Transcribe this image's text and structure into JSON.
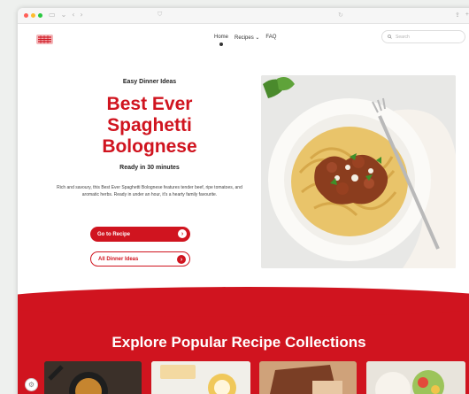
{
  "colors": {
    "brand": "#d0141f",
    "text": "#222222",
    "background": "#ffffff"
  },
  "browser": {
    "traffic_lights": [
      "#ff5f57",
      "#febc2e",
      "#28c840"
    ],
    "icons": [
      "sidebar-icon",
      "back-icon",
      "forward-icon",
      "shield-icon",
      "refresh-icon",
      "share-icon",
      "new-tab-icon"
    ]
  },
  "nav": {
    "links": [
      {
        "label": "Home"
      },
      {
        "label": "Recipes ⌄"
      },
      {
        "label": "FAQ"
      }
    ],
    "search_placeholder": "Search"
  },
  "hero": {
    "eyebrow": "Easy Dinner Ideas",
    "title_lines": [
      "Best Ever",
      "Spaghetti",
      "Bolognese"
    ],
    "ready": "Ready in 30 minutes",
    "description": "Rich and savoury, this Best Ever Spaghetti Bolognese features tender beef, ripe tomatoes, and aromatic herbs. Ready in under an hour, it's a hearty family favourite.",
    "primary_button": "Go to Recipe",
    "secondary_button": "All Dinner Ideas",
    "image": "spaghetti-bolognese-photo"
  },
  "collections": {
    "title": "Explore Popular Recipe Collections",
    "cards": [
      "skillet-photo",
      "dessert-photo",
      "cake-slice-photo",
      "salad-photo"
    ]
  }
}
